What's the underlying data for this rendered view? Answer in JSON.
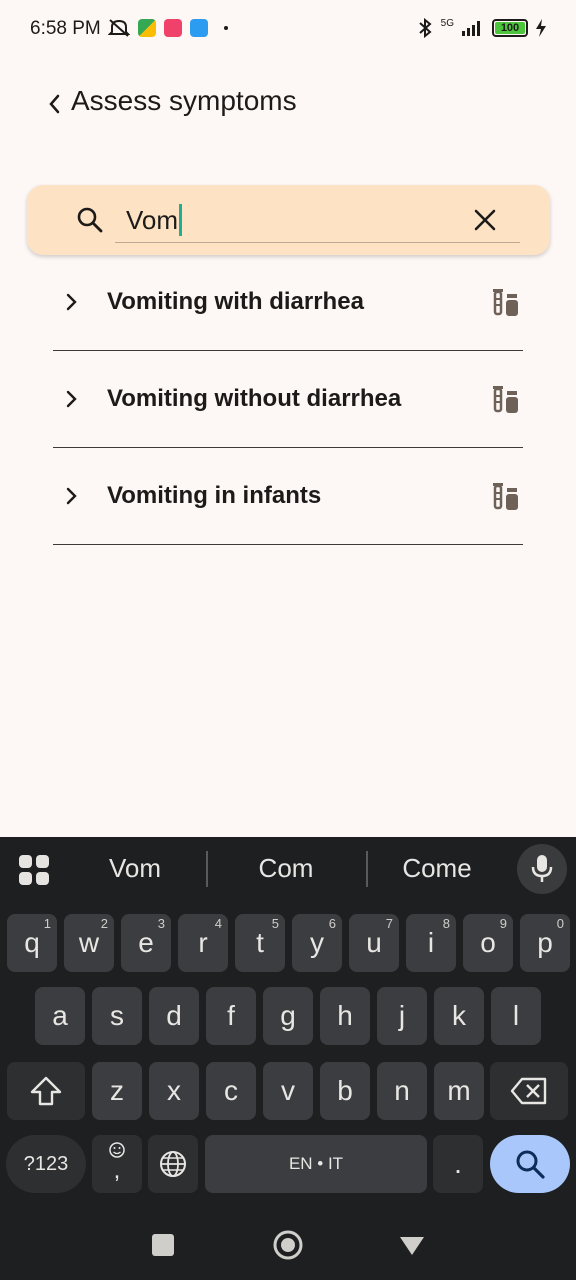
{
  "status_bar": {
    "time": "6:58 PM",
    "battery": "100",
    "network": "5G"
  },
  "header": {
    "title": "Assess symptoms"
  },
  "search": {
    "value": "Vom"
  },
  "results": [
    {
      "label": "Vomiting with diarrhea"
    },
    {
      "label": "Vomiting without diarrhea"
    },
    {
      "label": "Vomiting in infants"
    }
  ],
  "keyboard": {
    "suggestions": [
      "Vom",
      "Com",
      "Come"
    ],
    "row1": [
      {
        "k": "q",
        "h": "1"
      },
      {
        "k": "w",
        "h": "2"
      },
      {
        "k": "e",
        "h": "3"
      },
      {
        "k": "r",
        "h": "4"
      },
      {
        "k": "t",
        "h": "5"
      },
      {
        "k": "y",
        "h": "6"
      },
      {
        "k": "u",
        "h": "7"
      },
      {
        "k": "i",
        "h": "8"
      },
      {
        "k": "o",
        "h": "9"
      },
      {
        "k": "p",
        "h": "0"
      }
    ],
    "row2": [
      "a",
      "s",
      "d",
      "f",
      "g",
      "h",
      "j",
      "k",
      "l"
    ],
    "row3": [
      "z",
      "x",
      "c",
      "v",
      "b",
      "n",
      "m"
    ],
    "sym_label": "?123",
    "emoji_comma": ",",
    "space_label": "EN • IT",
    "period_label": "."
  },
  "colors": {
    "accent_caret": "#1fae94",
    "search_bg": "#fde2c4",
    "search_key": "#a9c7fa"
  }
}
